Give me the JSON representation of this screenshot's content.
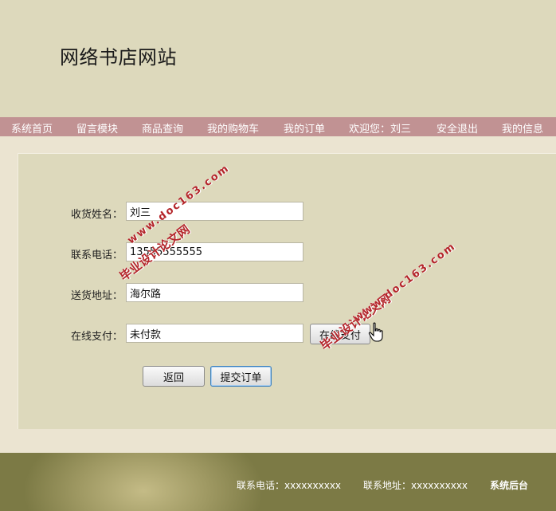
{
  "site": {
    "title": "网络书店网站"
  },
  "nav": {
    "items": [
      {
        "label": "系统首页"
      },
      {
        "label": "留言模块"
      },
      {
        "label": "商品查询"
      },
      {
        "label": "我的购物车"
      },
      {
        "label": "我的订单"
      },
      {
        "label": "欢迎您：刘三"
      },
      {
        "label": "安全退出"
      },
      {
        "label": "我的信息"
      }
    ]
  },
  "form": {
    "name_label": "收货姓名：",
    "name_value": "刘三",
    "phone_label": "联系电话：",
    "phone_value": "13555555555",
    "address_label": "送货地址：",
    "address_value": "海尔路",
    "payment_label": "在线支付：",
    "payment_value": "未付款",
    "pay_button": "在线支付",
    "back_button": "返回",
    "submit_button": "提交订单"
  },
  "watermark": {
    "cn": "毕业设计论文网",
    "url": "www.doc163.com"
  },
  "footer": {
    "phone": "联系电话：xxxxxxxxxx",
    "address": "联系地址：xxxxxxxxxx",
    "admin": "系统后台"
  },
  "colors": {
    "header_bg": "#ddd9bc",
    "nav_bg": "#c19293",
    "panel_bg": "#ddd9bc",
    "page_bg": "#ebe4d1",
    "watermark": "#b4252a"
  }
}
